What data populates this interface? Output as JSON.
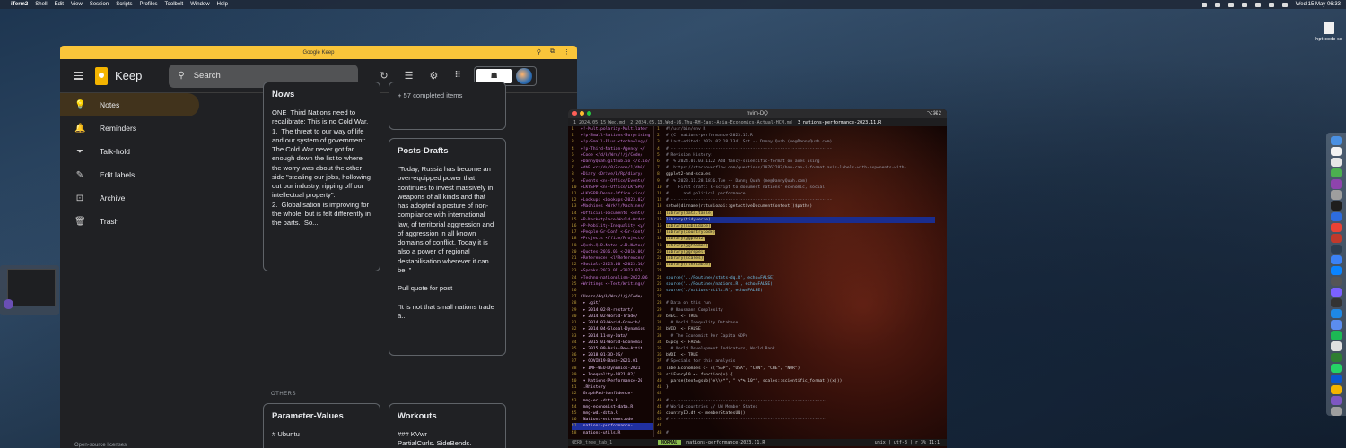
{
  "menubar": {
    "app": "iTerm2",
    "items": [
      "Shell",
      "Edit",
      "View",
      "Session",
      "Scripts",
      "Profiles",
      "Toolbelt",
      "Window",
      "Help"
    ],
    "clock": "Wed 15 May  06:33"
  },
  "desktop": {
    "file_label": "hpt-code-se"
  },
  "keep": {
    "window_title": "Google Keep",
    "app_name": "Keep",
    "search_placeholder": "Search",
    "sidebar": [
      {
        "label": "Notes",
        "icon": "lightbulb-icon"
      },
      {
        "label": "Reminders",
        "icon": "bell-icon"
      },
      {
        "label": "Talk-hold",
        "icon": "label-icon"
      },
      {
        "label": "Edit labels",
        "icon": "pencil-icon"
      },
      {
        "label": "Archive",
        "icon": "archive-icon"
      },
      {
        "label": "Trash",
        "icon": "trash-icon"
      }
    ],
    "open_source": "Open-source licenses",
    "others_label": "OTHERS",
    "cards": {
      "nows": {
        "title": "Nows",
        "body": "ONE  Third Nations need to recalibrate: This is no Cold War.\n1.  The threat to our way of life and our system of government: The Cold War never got far enough down the list to where the worry was about the other side \"stealing our jobs, hollowing out our industry, ripping off our intellectual property\".\n2.  Globalisation is improving for the whole, but is felt differently in the parts.  So..."
      },
      "completed": {
        "text": "+ 57 completed items"
      },
      "posts": {
        "title": "Posts-Drafts",
        "body": "\"Today, Russia has become an over-equipped power that continues to invest massively in weapons of all kinds and that has adopted a posture of non-compliance with international law, of territorial aggression and of aggression in all known domains of conflict. Today it is also a power of regional destabilisation wherever it can be. \"\n\nPull quote for post\n\n\"It is not that small nations trade a..."
      },
      "params": {
        "title": "Parameter-Values",
        "body": "# Ubuntu"
      },
      "workouts": {
        "title": "Workouts",
        "body": "### KVwr\nPartialCurls. SideBends."
      }
    }
  },
  "terminal": {
    "window_title": "nvim-DQ",
    "shortcut": "⌥⌘2",
    "tabs": [
      "1 2024.05.15.Wed.md",
      "2 2024.05.13.Wed-16.Thu-RH-East-Asia-Economics-Actual-HCM.md",
      "3 nations-performance-2023.11.R"
    ],
    "tree": [
      [
        "1",
        ">!-Multipolarity-Multilater"
      ],
      [
        "2",
        ">!p-Small-Nations-Surprising"
      ],
      [
        "3",
        ">!p-Small-Plus <technology/"
      ],
      [
        "4",
        ">!p-Third-Nation-Agency </"
      ],
      [
        "5",
        ">Code </d/0/Wrk/!/j/Code/"
      ],
      [
        "6",
        ">DannyQuah.github.io </c.io/"
      ],
      [
        "7",
        ">dbR <rs/dq/0/Scene/1/db0/"
      ],
      [
        "8",
        ">Diary <Drive/1/Rp/diary/"
      ],
      [
        "9",
        ">Events <ns-Office/Events/"
      ],
      [
        "10",
        ">LKYSPP <ns-Office/LKYSPP/"
      ],
      [
        "11",
        ">LKYSPP-Deans-Office <ice/"
      ],
      [
        "12",
        ">Lookups <Lookups-2023.02/"
      ],
      [
        "13",
        ">Machines <Wrk/!/Machines/"
      ],
      [
        "14",
        ">Official-Documents <ents/"
      ],
      [
        "15",
        ">P-Marketplace-World-Order"
      ],
      [
        "16",
        ">P-Mobility-Inequality <y/"
      ],
      [
        "17",
        ">People-Gr-Conf <-Gr-Conf/"
      ],
      [
        "18",
        ">Projects <ffice/Projects/"
      ],
      [
        "19",
        ">Quah-Q-R-Notes <-R-Notes/"
      ],
      [
        "20",
        ">Quotes-2016.06 <-2016.06/"
      ],
      [
        "21",
        ">References <l/References/"
      ],
      [
        "22",
        ">Socials-2023.10 <2023.10/"
      ],
      [
        "23",
        ">Speaks-2023.07 <2023.07/"
      ],
      [
        "24",
        ">Techno-nationalism-2022.06"
      ],
      [
        "25",
        ">Writings <-Text/Writings/"
      ],
      [
        "26",
        ""
      ],
      [
        "27",
        "/Users/dq/0/Wrk/!/j/Code/"
      ],
      [
        "28",
        "  ▸ .git/"
      ],
      [
        "29",
        "  ▸ 2014.02-R-restart/"
      ],
      [
        "30",
        "  ▸ 2014.02-World-Trade/"
      ],
      [
        "31",
        "  ▸ 2014.03-World-Growth/"
      ],
      [
        "32",
        "  ▸ 2014.04-Global-Dynamics"
      ],
      [
        "33",
        "  ▸ 2014.11-my-Data/"
      ],
      [
        "34",
        "  ▸ 2015.01-World-Economic"
      ],
      [
        "35",
        "  ▸ 2015.09-Asia-Pew-Attit"
      ],
      [
        "36",
        "  ▸ 2018.01-3D-DS/"
      ],
      [
        "37",
        "  ▸ COVID19-Base-2021.01"
      ],
      [
        "38",
        "  ▸ IMF-WEO-Dynamics-2021"
      ],
      [
        "39",
        "  ▸ Inequality-2021.02/"
      ],
      [
        "40",
        "  ▾ Nations-Performance-20"
      ],
      [
        "41",
        "      .Rhistory"
      ],
      [
        "42",
        "      GraphPad-Confidence-"
      ],
      [
        "43",
        "      mng-eci-data.R"
      ],
      [
        "44",
        "      mng-economist-data.R"
      ],
      [
        "45",
        "      mng-wdi-data.R"
      ],
      [
        "46",
        "      Nations-extremes.ode"
      ],
      [
        "47",
        "      nations-performance-"
      ],
      [
        "48",
        "      nations-utils.R"
      ]
    ],
    "code": [
      [
        "1",
        "#!/usr/bin/env R"
      ],
      [
        "2",
        "# (C) nations-performance-2023.11.R"
      ],
      [
        "3",
        "# Last-edited: 2024.02.18.1341.Sat -- Danny Quah (me@DannyQuah.com)"
      ],
      [
        "4",
        "# -----------------------------------------------------------------"
      ],
      [
        "5",
        "# Revision History:"
      ],
      [
        "6",
        "#  % 2024.01.03.1122 Add fancy-scientific-format on axes using"
      ],
      [
        "7",
        "#  https://stackoverflow.com/questions/10762287/how-can-i-format-axis-labels-with-exponents-with-"
      ],
      [
        "8",
        "ggplot2-and-scales"
      ],
      [
        "9",
        "#  % 2023.11.28.1816.Tue -- Danny Quah (me@DannyQuah.com)"
      ],
      [
        "10",
        "#    First draft: R-script to document nations' economic, social,"
      ],
      [
        "11",
        "#      and political performance"
      ],
      [
        "12",
        "# -----------------------------------------------------------------"
      ],
      [
        "13",
        "setwd(dirname(rstudioapi::getActiveDocumentContext()$path))"
      ],
      [
        "14",
        "library(data.table)"
      ],
      [
        "15",
        "library(tidyverse)"
      ],
      [
        "16",
        "library(lubridate)"
      ],
      [
        "17",
        "library(countrycode)"
      ],
      [
        "18",
        "library(ggplot2)"
      ],
      [
        "19",
        "library(ggthemes)"
      ],
      [
        "20",
        "library(ggrepel)"
      ],
      [
        "21",
        "library(scales)"
      ],
      [
        "22",
        "library(flextable)"
      ],
      [
        "23",
        ""
      ],
      [
        "24",
        "source('../Routines/stats-dq.R', echo=FALSE)"
      ],
      [
        "25",
        "source('../Routines/nations.R', echo=FALSE)"
      ],
      [
        "26",
        "source('./nations-utils.R', echo=FALSE)"
      ],
      [
        "27",
        ""
      ],
      [
        "28",
        "# Data on this run"
      ],
      [
        "29",
        "  # Hausmann Complexity"
      ],
      [
        "30",
        "bHECI <- TRUE"
      ],
      [
        "31",
        "  # World Inequality Database"
      ],
      [
        "32",
        "bWID  <- FALSE"
      ],
      [
        "33",
        "  # The Economist Per Capita GDPs"
      ],
      [
        "34",
        "bEpcg <- FALSE"
      ],
      [
        "35",
        "  # World Development Indicators, World Bank"
      ],
      [
        "36",
        "bWDI  <- TRUE"
      ],
      [
        "37",
        "# Specials for this analysis"
      ],
      [
        "38",
        "labelEconomies <- c(\"SGP\", \"USA\", \"CHN\", \"CHE\", \"NOR\")"
      ],
      [
        "39",
        "sciFancy10 <- function(x) {"
      ],
      [
        "40",
        "  parse(text=gsub(\"e\\\\+*\", \" %*% 10^\", scales::scientific_format()(x)))"
      ],
      [
        "41",
        "}"
      ],
      [
        "42",
        ""
      ],
      [
        "43",
        "# ---------------------------------------------------------------"
      ],
      [
        "44",
        "# World-countries // UN Member States"
      ],
      [
        "45",
        "countryID.dt <- memberStatesUN()"
      ],
      [
        "46",
        "# ---------------------------------------------------------------"
      ],
      [
        "47",
        ""
      ],
      [
        "48",
        "# "
      ]
    ],
    "status": {
      "tree_label": "NERD_tree_tab_1",
      "mode": "NORMAL",
      "file": "nations-performance-2023.11.R",
      "right": "unix | utf-8 | r    3%    11:1"
    }
  },
  "dock": {
    "colors": [
      "#4a90e2",
      "#f2f2f2",
      "#e6e6e6",
      "#4caf50",
      "#8e44ad",
      "#9e9e9e",
      "#1e1e1e",
      "#2d6cdf",
      "#e94235",
      "#c0392b",
      "#2c3e50",
      "#3b82f6",
      "#0a84ff",
      "#555",
      "#7b61ff",
      "#333",
      "#1e88e5",
      "#5b8def",
      "#1db954",
      "#e0e0e0",
      "#2e7d32",
      "#25d366",
      "#0b57d0",
      "#f4b400",
      "#7e57c2",
      "#9e9e9e"
    ]
  }
}
